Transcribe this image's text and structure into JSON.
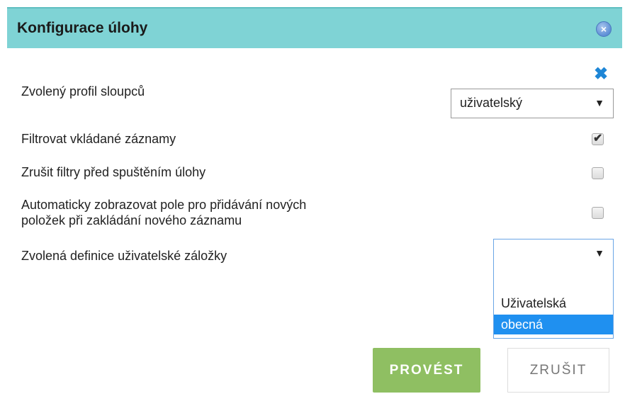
{
  "dialog": {
    "title": "Konfigurace úlohy",
    "close_glyph": "×",
    "reset_glyph": "✖"
  },
  "fields": {
    "column_profile": {
      "label": "Zvolený profil sloupců",
      "value": "uživatelský",
      "arrow": "▼"
    },
    "filter_inserted": {
      "label": "Filtrovat vkládané záznamy",
      "checked": true,
      "tick": "✔"
    },
    "clear_filters": {
      "label": "Zrušit filtry před spuštěním úlohy",
      "checked": false
    },
    "auto_show_fields": {
      "label_line1": "Automaticky zobrazovat pole pro přidávání nových",
      "label_line2": "položek při zakládání nového záznamu",
      "checked": false
    },
    "user_tab_definition": {
      "label": "Zvolená definice uživatelské záložky",
      "value": "",
      "arrow": "▼",
      "options": [
        "",
        "Uživatelská",
        "obecná"
      ],
      "highlighted": "obecná"
    }
  },
  "buttons": {
    "ok": "PROVÉST",
    "cancel": "ZRUŠIT"
  },
  "colors": {
    "header": "#7fd3d5",
    "ok_button": "#8fbf62",
    "highlight": "#1f90f0",
    "reset_icon": "#1e86d6"
  }
}
